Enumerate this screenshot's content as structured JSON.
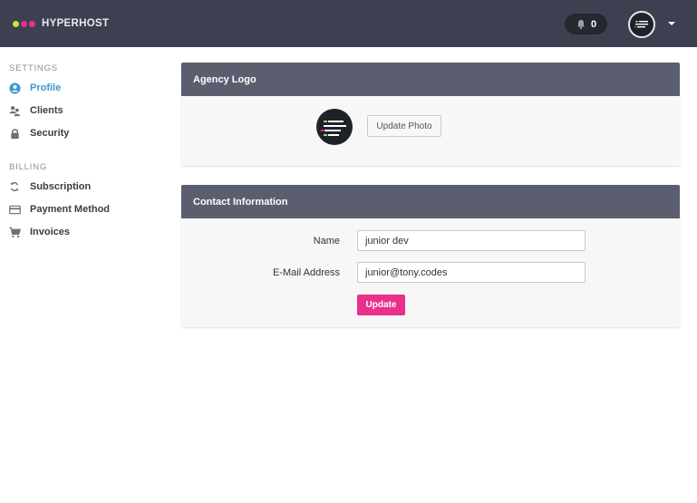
{
  "navbar": {
    "brand": "HYPERHOST",
    "brand_dots": [
      "#9be03a",
      "#e8308c",
      "#e8308c"
    ],
    "notifications_count": "0"
  },
  "sidebar": {
    "settings_heading": "SETTINGS",
    "settings_items": [
      {
        "label": "Profile",
        "icon": "user-circle-icon",
        "active": true
      },
      {
        "label": "Clients",
        "icon": "users-icon"
      },
      {
        "label": "Security",
        "icon": "lock-icon"
      }
    ],
    "billing_heading": "BILLING",
    "billing_items": [
      {
        "label": "Subscription",
        "icon": "refresh-icon"
      },
      {
        "label": "Payment Method",
        "icon": "credit-card-icon"
      },
      {
        "label": "Invoices",
        "icon": "cart-icon"
      }
    ]
  },
  "agency_logo": {
    "title": "Agency Logo",
    "update_photo_label": "Update Photo"
  },
  "contact": {
    "title": "Contact Information",
    "name_label": "Name",
    "name_value": "junior dev",
    "email_label": "E-Mail Address",
    "email_value": "junior@tony.codes",
    "update_label": "Update"
  },
  "colors": {
    "navbar": "#3c4050",
    "panel_header": "#5b5e6e",
    "accent_blue": "#3d98d0",
    "accent_pink": "#e8308c"
  }
}
